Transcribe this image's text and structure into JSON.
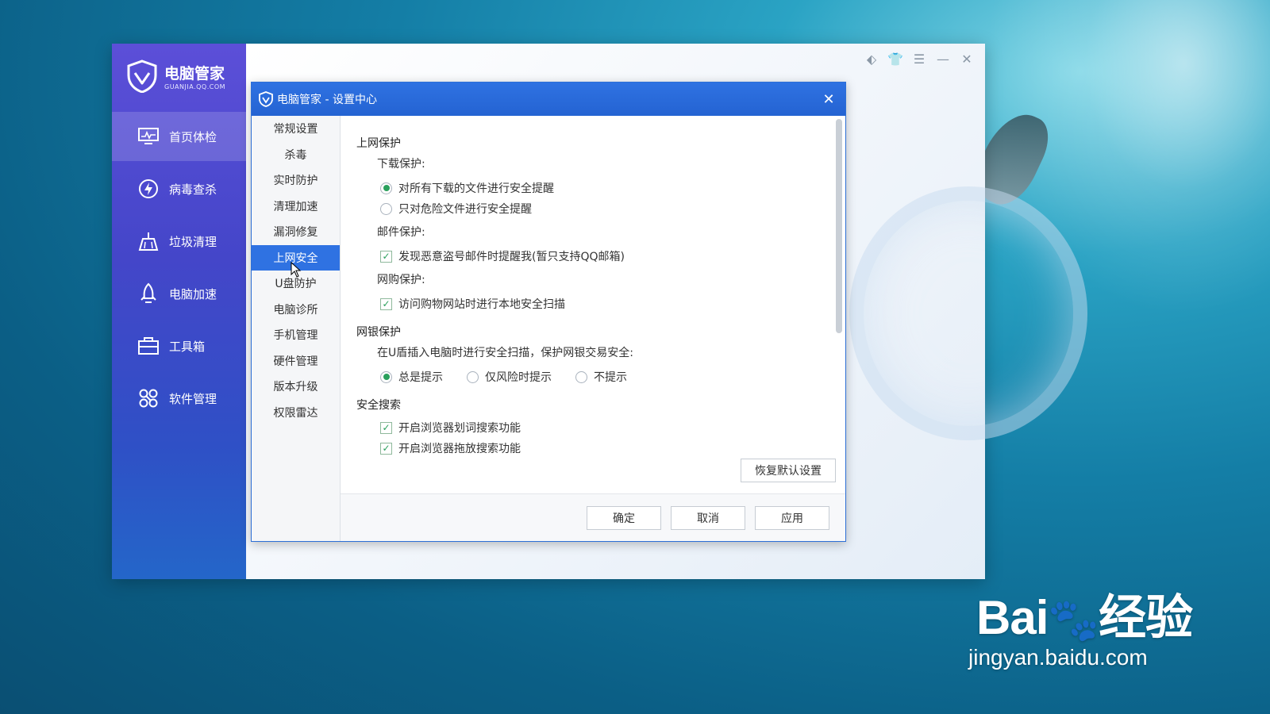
{
  "app": {
    "brand_title": "电脑管家",
    "brand_sub": "GUANJIA.QQ.COM",
    "nav": [
      {
        "label": "首页体检",
        "icon": "monitor-icon",
        "active": true
      },
      {
        "label": "病毒查杀",
        "icon": "lightning-shield-icon",
        "active": false
      },
      {
        "label": "垃圾清理",
        "icon": "broom-icon",
        "active": false
      },
      {
        "label": "电脑加速",
        "icon": "rocket-icon",
        "active": false
      },
      {
        "label": "工具箱",
        "icon": "toolbox-icon",
        "active": false
      },
      {
        "label": "软件管理",
        "icon": "software-icon",
        "active": false
      }
    ],
    "controls": [
      "pin-icon",
      "skin-icon",
      "menu-icon",
      "minimize-icon",
      "close-icon"
    ]
  },
  "dialog": {
    "title": "电脑管家 - 设置中心",
    "side_items": [
      "常规设置",
      "杀毒",
      "实时防护",
      "清理加速",
      "漏洞修复",
      "上网安全",
      "U盘防护",
      "电脑诊所",
      "手机管理",
      "硬件管理",
      "版本升级",
      "权限雷达"
    ],
    "active_index": 5,
    "sections": {
      "web_protect": {
        "title": "上网保护",
        "download_label": "下载保护:",
        "download_opt1": "对所有下载的文件进行安全提醒",
        "download_opt2": "只对危险文件进行安全提醒",
        "mail_label": "邮件保护:",
        "mail_opt": "发现恶意盗号邮件时提醒我(暂只支持QQ邮箱)",
        "shop_label": "网购保护:",
        "shop_opt": "访问购物网站时进行本地安全扫描"
      },
      "bank_protect": {
        "title": "网银保护",
        "desc": "在U盾插入电脑时进行安全扫描，保护网银交易安全:",
        "opt1": "总是提示",
        "opt2": "仅风险时提示",
        "opt3": "不提示"
      },
      "safe_search": {
        "title": "安全搜索",
        "opt1": "开启浏览器划词搜索功能",
        "opt2": "开启浏览器拖放搜索功能"
      }
    },
    "restore_label": "恢复默认设置",
    "ok_label": "确定",
    "cancel_label": "取消",
    "apply_label": "应用"
  },
  "watermark": {
    "logo": "Bai",
    "logo_cn": "经验",
    "url": "jingyan.baidu.com"
  }
}
